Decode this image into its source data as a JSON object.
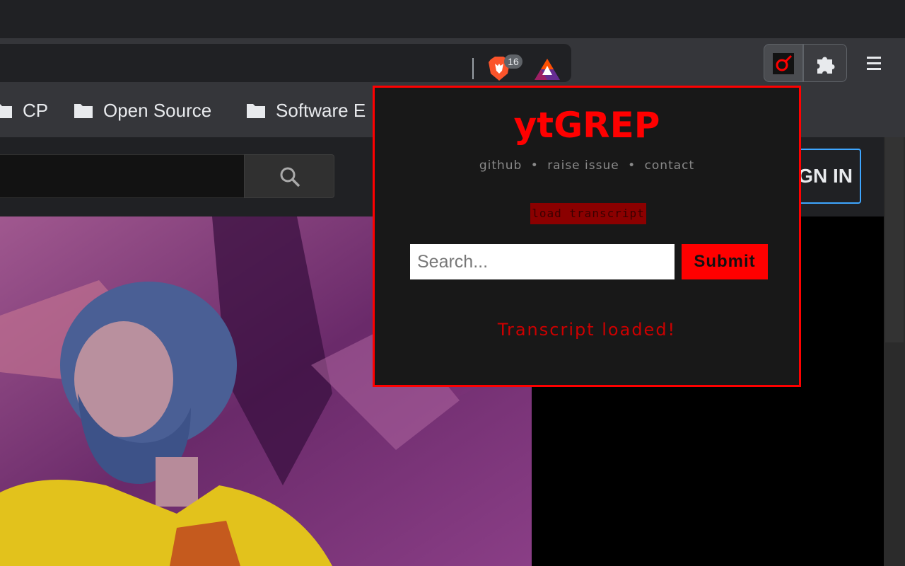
{
  "toolbar": {
    "brave_shields_count": "16"
  },
  "bookmarks": {
    "items": [
      {
        "label": "CP"
      },
      {
        "label": "Open Source"
      },
      {
        "label": "Software E"
      }
    ]
  },
  "youtube": {
    "signin_label": "SIGN IN"
  },
  "popup": {
    "title": "ytGREP",
    "links": [
      "github",
      "raise issue",
      "contact"
    ],
    "separator": "•",
    "load_button": "load transcript",
    "search_placeholder": "Search...",
    "submit_label": "Submit",
    "status": "Transcript loaded!"
  },
  "colors": {
    "accent": "#ff0000",
    "popup_bg": "#181818",
    "load_button_bg": "#8b0000",
    "status_text": "#cc0000"
  }
}
